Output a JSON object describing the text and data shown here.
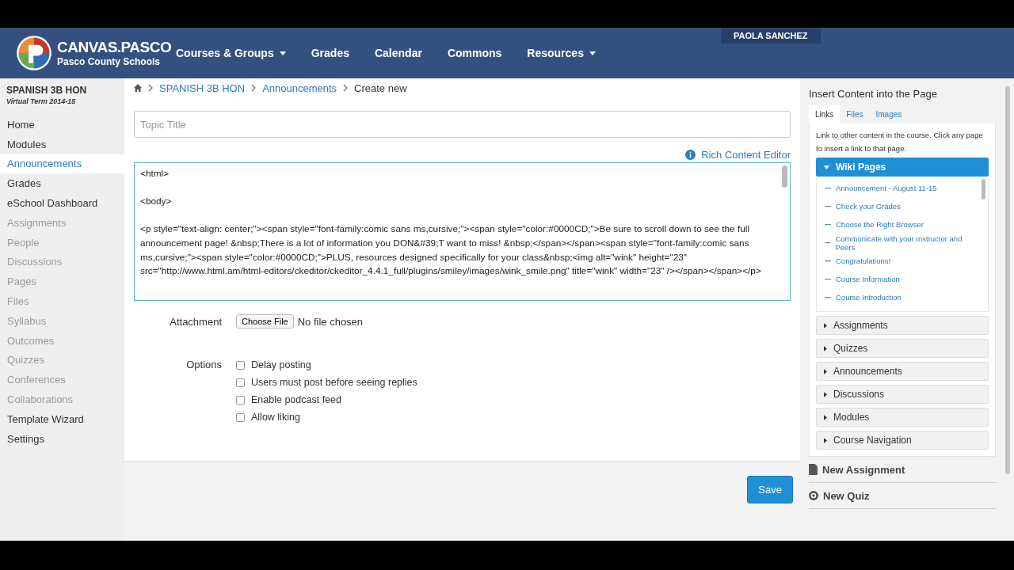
{
  "header": {
    "logo_title": "CANVAS.PASCO",
    "logo_subtitle": "Pasco County Schools",
    "nav": [
      {
        "label": "Courses & Groups",
        "has_menu": true
      },
      {
        "label": "Grades",
        "has_menu": false
      },
      {
        "label": "Calendar",
        "has_menu": false
      },
      {
        "label": "Commons",
        "has_menu": false
      },
      {
        "label": "Resources",
        "has_menu": true
      }
    ],
    "user": "PAOLA SANCHEZ"
  },
  "sidebar": {
    "course": "SPANISH 3B HON",
    "term": "Virtual Term 2014-15",
    "items": [
      {
        "label": "Home",
        "selected": false,
        "disabled": false
      },
      {
        "label": "Modules",
        "selected": false,
        "disabled": false
      },
      {
        "label": "Announcements",
        "selected": true,
        "disabled": false
      },
      {
        "label": "Grades",
        "selected": false,
        "disabled": false
      },
      {
        "label": "eSchool Dashboard",
        "selected": false,
        "disabled": false
      },
      {
        "label": "Assignments",
        "selected": false,
        "disabled": true
      },
      {
        "label": "People",
        "selected": false,
        "disabled": true
      },
      {
        "label": "Discussions",
        "selected": false,
        "disabled": true
      },
      {
        "label": "Pages",
        "selected": false,
        "disabled": true
      },
      {
        "label": "Files",
        "selected": false,
        "disabled": true
      },
      {
        "label": "Syllabus",
        "selected": false,
        "disabled": true
      },
      {
        "label": "Outcomes",
        "selected": false,
        "disabled": true
      },
      {
        "label": "Quizzes",
        "selected": false,
        "disabled": true
      },
      {
        "label": "Conferences",
        "selected": false,
        "disabled": true
      },
      {
        "label": "Collaborations",
        "selected": false,
        "disabled": true
      },
      {
        "label": "Template Wizard",
        "selected": false,
        "disabled": false
      },
      {
        "label": "Settings",
        "selected": false,
        "disabled": false
      }
    ]
  },
  "breadcrumb": [
    {
      "label": "SPANISH 3B HON",
      "kind": "link"
    },
    {
      "label": "Announcements",
      "kind": "link"
    },
    {
      "label": "Create new",
      "kind": "current"
    }
  ],
  "topic_title": {
    "placeholder": "Topic Title"
  },
  "editor_toggle": "Rich Content Editor",
  "html_source": [
    "<html>",
    "<body>",
    "<p style=\"text-align: center;\"><span style=\"font-family:comic sans ms,cursive;\"><span style=\"color:#0000CD;\">Be sure to scroll down to see the full announcement page! &nbsp;There is a lot of information you DON&#39;T want to miss! &nbsp;</span></span><span style=\"font-family:comic sans ms,cursive;\"><span style=\"color:#0000CD;\">PLUS, resources designed specifically for your class&nbsp;<img alt=\"wink\" height=\"23\" src=\"http://www.html.am/html-editors/ckeditor/ckeditor_4.4.1_full/plugins/smiley/images/wink_smile.png\" title=\"wink\" width=\"23\" /></span></span></p>"
  ],
  "attachment": {
    "label": "Attachment",
    "button": "Choose File",
    "status": "No file chosen"
  },
  "options": {
    "label": "Options",
    "items": [
      {
        "label": "Delay posting",
        "checked": false
      },
      {
        "label": "Users must post before seeing replies",
        "checked": false
      },
      {
        "label": "Enable podcast feed",
        "checked": false
      },
      {
        "label": "Allow liking",
        "checked": false
      }
    ]
  },
  "save_button": "Save",
  "insert_panel": {
    "title": "Insert Content into the Page",
    "tabs": [
      {
        "label": "Links",
        "selected": true
      },
      {
        "label": "Files",
        "selected": false
      },
      {
        "label": "Images",
        "selected": false
      }
    ],
    "description": "Link to other content in the course. Click any page to insert a link to that page.",
    "sections": [
      {
        "label": "Wiki Pages",
        "expanded": true,
        "children": [
          {
            "label": "Announcement - August 11-15"
          },
          {
            "label": "Check your Grades"
          },
          {
            "label": "Choose the Right Browser"
          },
          {
            "label": "Communicate with your Instructor and Peers"
          },
          {
            "label": "Congratulations!"
          },
          {
            "label": "Course Information"
          },
          {
            "label": "Course Introduction"
          }
        ]
      },
      {
        "label": "Assignments",
        "expanded": false
      },
      {
        "label": "Quizzes",
        "expanded": false
      },
      {
        "label": "Announcements",
        "expanded": false
      },
      {
        "label": "Discussions",
        "expanded": false
      },
      {
        "label": "Modules",
        "expanded": false
      },
      {
        "label": "Course Navigation",
        "expanded": false
      }
    ],
    "actions": [
      {
        "label": "New Assignment",
        "kind": "assignment"
      },
      {
        "label": "New Quiz",
        "kind": "quiz"
      }
    ]
  }
}
